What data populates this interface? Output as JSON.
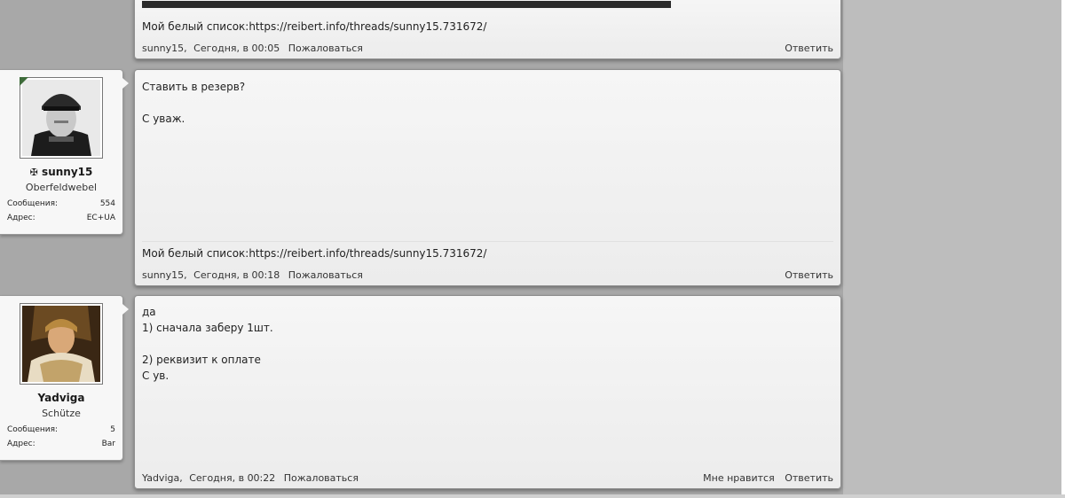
{
  "posts": [
    {
      "signature": "Мой белый список:https://reibert.info/threads/sunny15.731672/",
      "author": "sunny15",
      "date": "Сегодня, в 00:05",
      "report": "Пожаловаться",
      "reply": "Ответить"
    },
    {
      "user": {
        "name": "sunny15",
        "rank": "Oberfeldwebel",
        "messages_label": "Сообщения:",
        "messages": "554",
        "address_label": "Адрес:",
        "address": "ЕС+UA",
        "name_icon": "iron-cross-icon"
      },
      "text": "Ставить в резерв?\n\nС уваж.",
      "signature": "Мой белый список:https://reibert.info/threads/sunny15.731672/",
      "author": "sunny15",
      "date": "Сегодня, в 00:18",
      "report": "Пожаловаться",
      "reply": "Ответить"
    },
    {
      "user": {
        "name": "Yadviga",
        "rank": "Schütze",
        "messages_label": "Сообщения:",
        "messages": "5",
        "address_label": "Адрес:",
        "address": "Bar"
      },
      "text": "да\n1) сначала заберу 1шт.\n\n2) реквизит к оплате\nС ув.",
      "author": "Yadviga",
      "date": "Сегодня, в 00:22",
      "report": "Пожаловаться",
      "like": "Мне нравится",
      "reply": "Ответить"
    }
  ]
}
